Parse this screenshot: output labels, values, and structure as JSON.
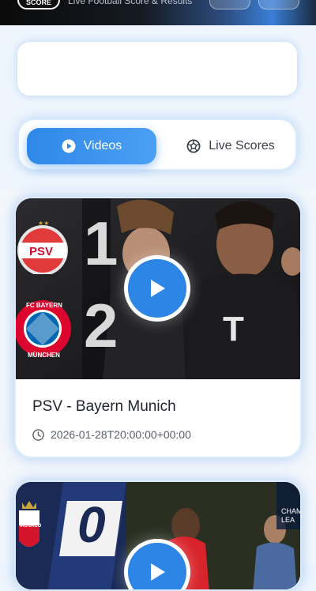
{
  "header": {
    "logo_text": "SCORE",
    "tagline": "Live Football Score & Results"
  },
  "tabs": [
    {
      "label": "Videos",
      "icon": "play-circle-icon",
      "active": true
    },
    {
      "label": "Live Scores",
      "icon": "soccer-ball-icon",
      "active": false
    }
  ],
  "videos": [
    {
      "title": "PSV - Bayern Munich",
      "timestamp": "2026-01-28T20:00:00+00:00",
      "thumbnail": {
        "home_badge": "PSV",
        "away_badge": "FC BAYERN MÜNCHEN",
        "home_score": "1",
        "away_score": "2"
      }
    },
    {
      "title": "",
      "timestamp": "",
      "thumbnail": {
        "home_badge": "MONACO",
        "home_score": "0",
        "corner_text": "CHAMP LEA"
      }
    }
  ],
  "colors": {
    "accent": "#2f87e8",
    "background": "#eef5fd"
  }
}
